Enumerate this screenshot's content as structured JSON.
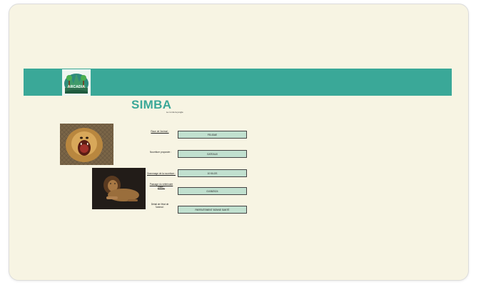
{
  "logo": {
    "text": "ARCADIA"
  },
  "profile": {
    "name": "SIMBA",
    "subtitle": "Le roi de la jungle"
  },
  "fields": [
    {
      "label": "Race de l'animal :",
      "value": "FELIDAE"
    },
    {
      "label": "Nourriture proposée :",
      "value": "GATEAUX"
    },
    {
      "label": "Grammage de la nourriture :",
      "value": "10 KILOS"
    },
    {
      "label": "Passage du vétérinaire (date) :",
      "value": "01/08/2024"
    },
    {
      "label": "Détail de l'état de l'animal :",
      "value": "PARFAITEMENT BONNE SANTÉ"
    }
  ],
  "images": [
    {
      "alt": "lion-roaring-photo"
    },
    {
      "alt": "lion-resting-photo"
    }
  ],
  "colors": {
    "banner": "#3aa898",
    "title": "#3aa898",
    "background": "#f7f4e3",
    "field": "#c1e0cf"
  }
}
